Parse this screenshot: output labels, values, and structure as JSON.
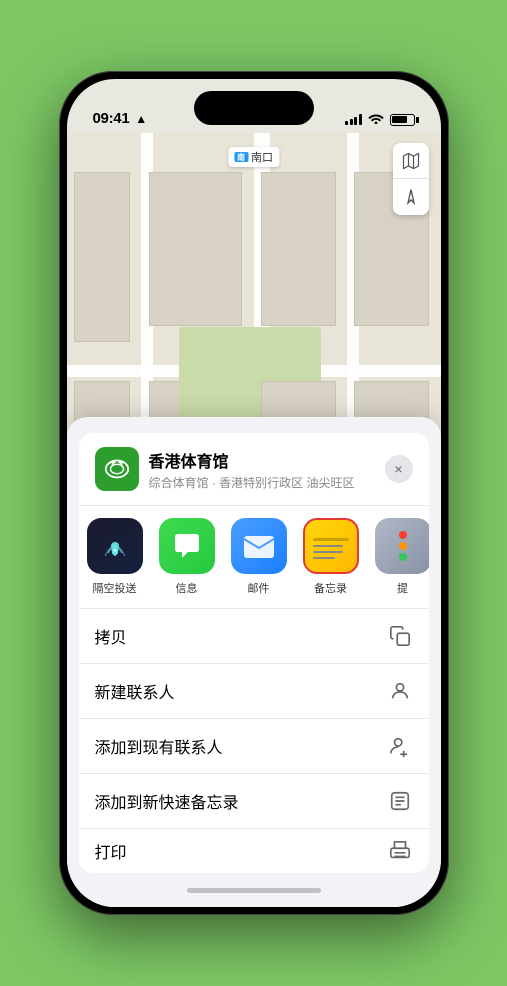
{
  "status_bar": {
    "time": "09:41",
    "location_indicator": "▲"
  },
  "map": {
    "location_label": "南口",
    "stadium_name": "香港体育馆",
    "controls": {
      "map_icon": "🗺",
      "location_icon": "➤"
    }
  },
  "bottom_sheet": {
    "venue": {
      "name": "香港体育馆",
      "subtitle": "综合体育馆 · 香港特别行政区 油尖旺区"
    },
    "close_label": "×",
    "share_actions": [
      {
        "id": "airdrop",
        "label": "隔空投送"
      },
      {
        "id": "messages",
        "label": "信息"
      },
      {
        "id": "mail",
        "label": "邮件"
      },
      {
        "id": "notes",
        "label": "备忘录"
      },
      {
        "id": "more",
        "label": "提"
      }
    ],
    "action_items": [
      {
        "id": "copy",
        "label": "拷贝",
        "icon": "copy"
      },
      {
        "id": "new-contact",
        "label": "新建联系人",
        "icon": "person"
      },
      {
        "id": "add-contact",
        "label": "添加到现有联系人",
        "icon": "person-add"
      },
      {
        "id": "add-note",
        "label": "添加到新快速备忘录",
        "icon": "note"
      },
      {
        "id": "print",
        "label": "打印",
        "icon": "printer"
      }
    ]
  }
}
